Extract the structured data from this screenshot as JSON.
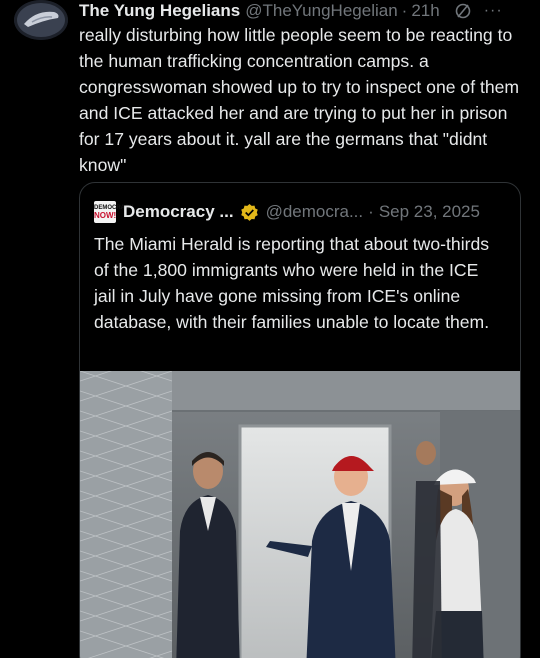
{
  "tweet": {
    "display_name": "The Yung Hegelians",
    "handle": "@TheYungHegelian",
    "separator": "·",
    "time": "21h",
    "more": "···",
    "text": "really disturbing how little people seem to be reacting to the human trafficking concentration camps. a congresswoman showed up to try to inspect one of them and ICE attacked her and are trying to put her in prison for 17 years about it. yall are the germans that \"didnt know\""
  },
  "quote": {
    "logo_top": "DEMOCRACY",
    "logo_bottom": "NOW!",
    "display_name": "Democracy ...",
    "handle": "@democra...",
    "separator": "·",
    "date": "Sep 23, 2025",
    "text": "The Miami Herald is reporting that about two-thirds of the 1,800 immigrants who were held in the ICE jail in July have gone missing from ICE's online database, with their families unable to locate them."
  },
  "colors": {
    "background": "#000000",
    "text_primary": "#e7e9ea",
    "text_secondary": "#71767b",
    "border": "#2f3336",
    "verified_gold": "#e2b719",
    "logo_red": "#c8102e"
  },
  "icons": [
    "avatar",
    "grok-icon",
    "more-icon",
    "democracy-now-logo",
    "verified-gold-badge"
  ]
}
